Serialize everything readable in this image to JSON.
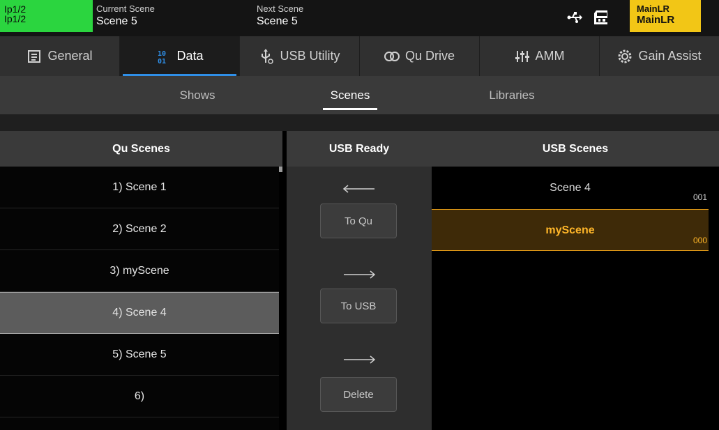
{
  "status_bar": {
    "channel_line1": "Ip1/2",
    "channel_line2": "Ip1/2",
    "channel_color": "#2bd53f",
    "current_scene_caption": "Current Scene",
    "current_scene_value": "Scene 5",
    "next_scene_caption": "Next Scene",
    "next_scene_value": "Scene 5",
    "usb_icon": "usb-icon",
    "sd_icon": "sd-card-icon",
    "mix_line1": "MainLR",
    "mix_line2": "MainLR",
    "mix_color": "#f2c616"
  },
  "tabs": [
    {
      "label": "General",
      "icon": "document-icon",
      "active": false
    },
    {
      "label": "Data",
      "icon": "binary-data-icon",
      "active": true
    },
    {
      "label": "USB Utility",
      "icon": "usb-utility-icon",
      "active": false
    },
    {
      "label": "Qu Drive",
      "icon": "qu-drive-icon",
      "active": false
    },
    {
      "label": "AMM",
      "icon": "amm-icon",
      "active": false
    },
    {
      "label": "Gain Assist",
      "icon": "gain-assist-icon",
      "active": false
    }
  ],
  "subtabs": [
    {
      "label": "Shows",
      "active": false
    },
    {
      "label": "Scenes",
      "active": true
    },
    {
      "label": "Libraries",
      "active": false
    }
  ],
  "qu_scenes": {
    "header": "Qu Scenes",
    "items": [
      "1) Scene 1",
      "2) Scene 2",
      "3) myScene",
      "4) Scene 4",
      "5) Scene 5",
      "6)"
    ],
    "selected_index": 3
  },
  "transfer": {
    "header": "USB Ready",
    "to_qu_label": "To Qu",
    "to_usb_label": "To USB",
    "delete_label": "Delete"
  },
  "usb_scenes": {
    "header": "USB Scenes",
    "items": [
      {
        "name": "Scene 4",
        "number": "001",
        "highlighted": false
      },
      {
        "name": "myScene",
        "number": "000",
        "highlighted": true
      }
    ],
    "highlight_color": "#ffb629"
  },
  "accent_color": "#2f8fe8"
}
